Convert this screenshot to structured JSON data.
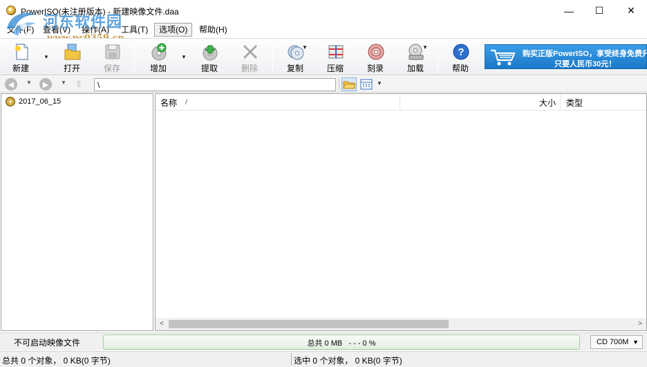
{
  "window": {
    "title": "PowerISO(未注册版本) - 新建映像文件.daa",
    "minimize": "—",
    "maximize": "☐",
    "close": "✕"
  },
  "watermark": {
    "name": "河东软件园",
    "url": "www.pc0359.cn"
  },
  "menu": {
    "items": [
      {
        "label": "文件(F)"
      },
      {
        "label": "查看(V)"
      },
      {
        "label": "操作(A)"
      },
      {
        "label": "工具(T)"
      },
      {
        "label": "选项(O)",
        "active": true
      },
      {
        "label": "帮助(H)"
      }
    ]
  },
  "toolbar": {
    "new": {
      "label": "新建",
      "icon": "new-file-icon"
    },
    "open": {
      "label": "打开",
      "icon": "open-folder-icon"
    },
    "save": {
      "label": "保存",
      "icon": "save-disk-icon",
      "disabled": true
    },
    "add": {
      "label": "增加",
      "icon": "add-icon"
    },
    "extract": {
      "label": "提取",
      "icon": "extract-icon"
    },
    "delete": {
      "label": "删除",
      "icon": "delete-icon",
      "disabled": true
    },
    "copy": {
      "label": "复制",
      "icon": "copy-disc-icon"
    },
    "compress": {
      "label": "压缩",
      "icon": "compress-icon"
    },
    "burn": {
      "label": "刻录",
      "icon": "burn-disc-icon"
    },
    "mount": {
      "label": "加载",
      "icon": "mount-drive-icon"
    },
    "help": {
      "label": "帮助",
      "icon": "help-icon"
    }
  },
  "ad": {
    "line1": "购买正版PowerISO，享受终身免费升",
    "line2": "只要人民币30元！",
    "icon": "shopping-cart-icon"
  },
  "addressbar": {
    "back": "back-icon",
    "forward": "forward-icon",
    "up": "up-icon",
    "path": "\\",
    "view_icon": "view-mode-icon"
  },
  "tree": {
    "root": "2017_06_15"
  },
  "list": {
    "columns": {
      "name": "名称",
      "size": "大小",
      "type": "类型"
    },
    "sort_indicator": "/",
    "rows": []
  },
  "capacity": {
    "boot_status": "不可启动映像文件",
    "summary": "总共 0 MB   - - - 0 %",
    "percent": 0,
    "disc_type": "CD 700M"
  },
  "status": {
    "total": "总共 0 个对象， 0 KB(0 字节)",
    "selected": "选中 0 个对象， 0 KB(0 字节)"
  },
  "colors": {
    "accent": "#1b78c8",
    "ad_background": "#2a8ad8",
    "gauge_border": "#a6c8a6"
  }
}
